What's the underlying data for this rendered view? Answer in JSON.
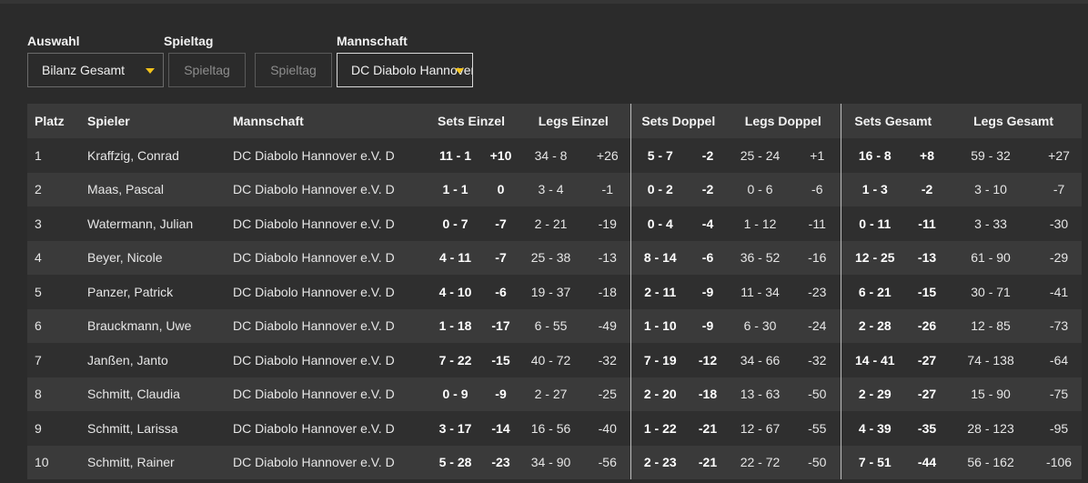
{
  "filters": {
    "auswahl": {
      "label": "Auswahl",
      "value": "Bilanz Gesamt"
    },
    "spieltag": {
      "label": "Spieltag",
      "boxes": [
        "Spieltag",
        "Spieltag"
      ]
    },
    "mannschaft": {
      "label": "Mannschaft",
      "value": "DC Diabolo Hannover e.V. D"
    }
  },
  "colors": {
    "accent": "#f2c21b",
    "background": "#2b2b2b",
    "header_bg": "#3a3a3a"
  },
  "table": {
    "headers": {
      "platz": "Platz",
      "spieler": "Spieler",
      "mannschaft": "Mannschaft",
      "sets_einzel": "Sets Einzel",
      "legs_einzel": "Legs Einzel",
      "sets_doppel": "Sets Doppel",
      "legs_doppel": "Legs Doppel",
      "sets_gesamt": "Sets Gesamt",
      "legs_gesamt": "Legs Gesamt"
    },
    "rows": [
      [
        "1",
        "Kraffzig, Conrad",
        "DC Diabolo Hannover e.V. D",
        "11 - 1",
        "+10",
        "34 - 8",
        "+26",
        "5 - 7",
        "-2",
        "25 - 24",
        "+1",
        "16 - 8",
        "+8",
        "59 - 32",
        "+27"
      ],
      [
        "2",
        "Maas, Pascal",
        "DC Diabolo Hannover e.V. D",
        "1 - 1",
        "0",
        "3 - 4",
        "-1",
        "0 - 2",
        "-2",
        "0 - 6",
        "-6",
        "1 - 3",
        "-2",
        "3 - 10",
        "-7"
      ],
      [
        "3",
        "Watermann, Julian",
        "DC Diabolo Hannover e.V. D",
        "0 - 7",
        "-7",
        "2 - 21",
        "-19",
        "0 - 4",
        "-4",
        "1 - 12",
        "-11",
        "0 - 11",
        "-11",
        "3 - 33",
        "-30"
      ],
      [
        "4",
        "Beyer, Nicole",
        "DC Diabolo Hannover e.V. D",
        "4 - 11",
        "-7",
        "25 - 38",
        "-13",
        "8 - 14",
        "-6",
        "36 - 52",
        "-16",
        "12 - 25",
        "-13",
        "61 - 90",
        "-29"
      ],
      [
        "5",
        "Panzer, Patrick",
        "DC Diabolo Hannover e.V. D",
        "4 - 10",
        "-6",
        "19 - 37",
        "-18",
        "2 - 11",
        "-9",
        "11 - 34",
        "-23",
        "6 - 21",
        "-15",
        "30 - 71",
        "-41"
      ],
      [
        "6",
        "Brauckmann, Uwe",
        "DC Diabolo Hannover e.V. D",
        "1 - 18",
        "-17",
        "6 - 55",
        "-49",
        "1 - 10",
        "-9",
        "6 - 30",
        "-24",
        "2 - 28",
        "-26",
        "12 - 85",
        "-73"
      ],
      [
        "7",
        "Janßen, Janto",
        "DC Diabolo Hannover e.V. D",
        "7 - 22",
        "-15",
        "40 - 72",
        "-32",
        "7 - 19",
        "-12",
        "34 - 66",
        "-32",
        "14 - 41",
        "-27",
        "74 - 138",
        "-64"
      ],
      [
        "8",
        "Schmitt, Claudia",
        "DC Diabolo Hannover e.V. D",
        "0 - 9",
        "-9",
        "2 - 27",
        "-25",
        "2 - 20",
        "-18",
        "13 - 63",
        "-50",
        "2 - 29",
        "-27",
        "15 - 90",
        "-75"
      ],
      [
        "9",
        "Schmitt, Larissa",
        "DC Diabolo Hannover e.V. D",
        "3 - 17",
        "-14",
        "16 - 56",
        "-40",
        "1 - 22",
        "-21",
        "12 - 67",
        "-55",
        "4 - 39",
        "-35",
        "28 - 123",
        "-95"
      ],
      [
        "10",
        "Schmitt, Rainer",
        "DC Diabolo Hannover e.V. D",
        "5 - 28",
        "-23",
        "34 - 90",
        "-56",
        "2 - 23",
        "-21",
        "22 - 72",
        "-50",
        "7 - 51",
        "-44",
        "56 - 162",
        "-106"
      ]
    ]
  }
}
